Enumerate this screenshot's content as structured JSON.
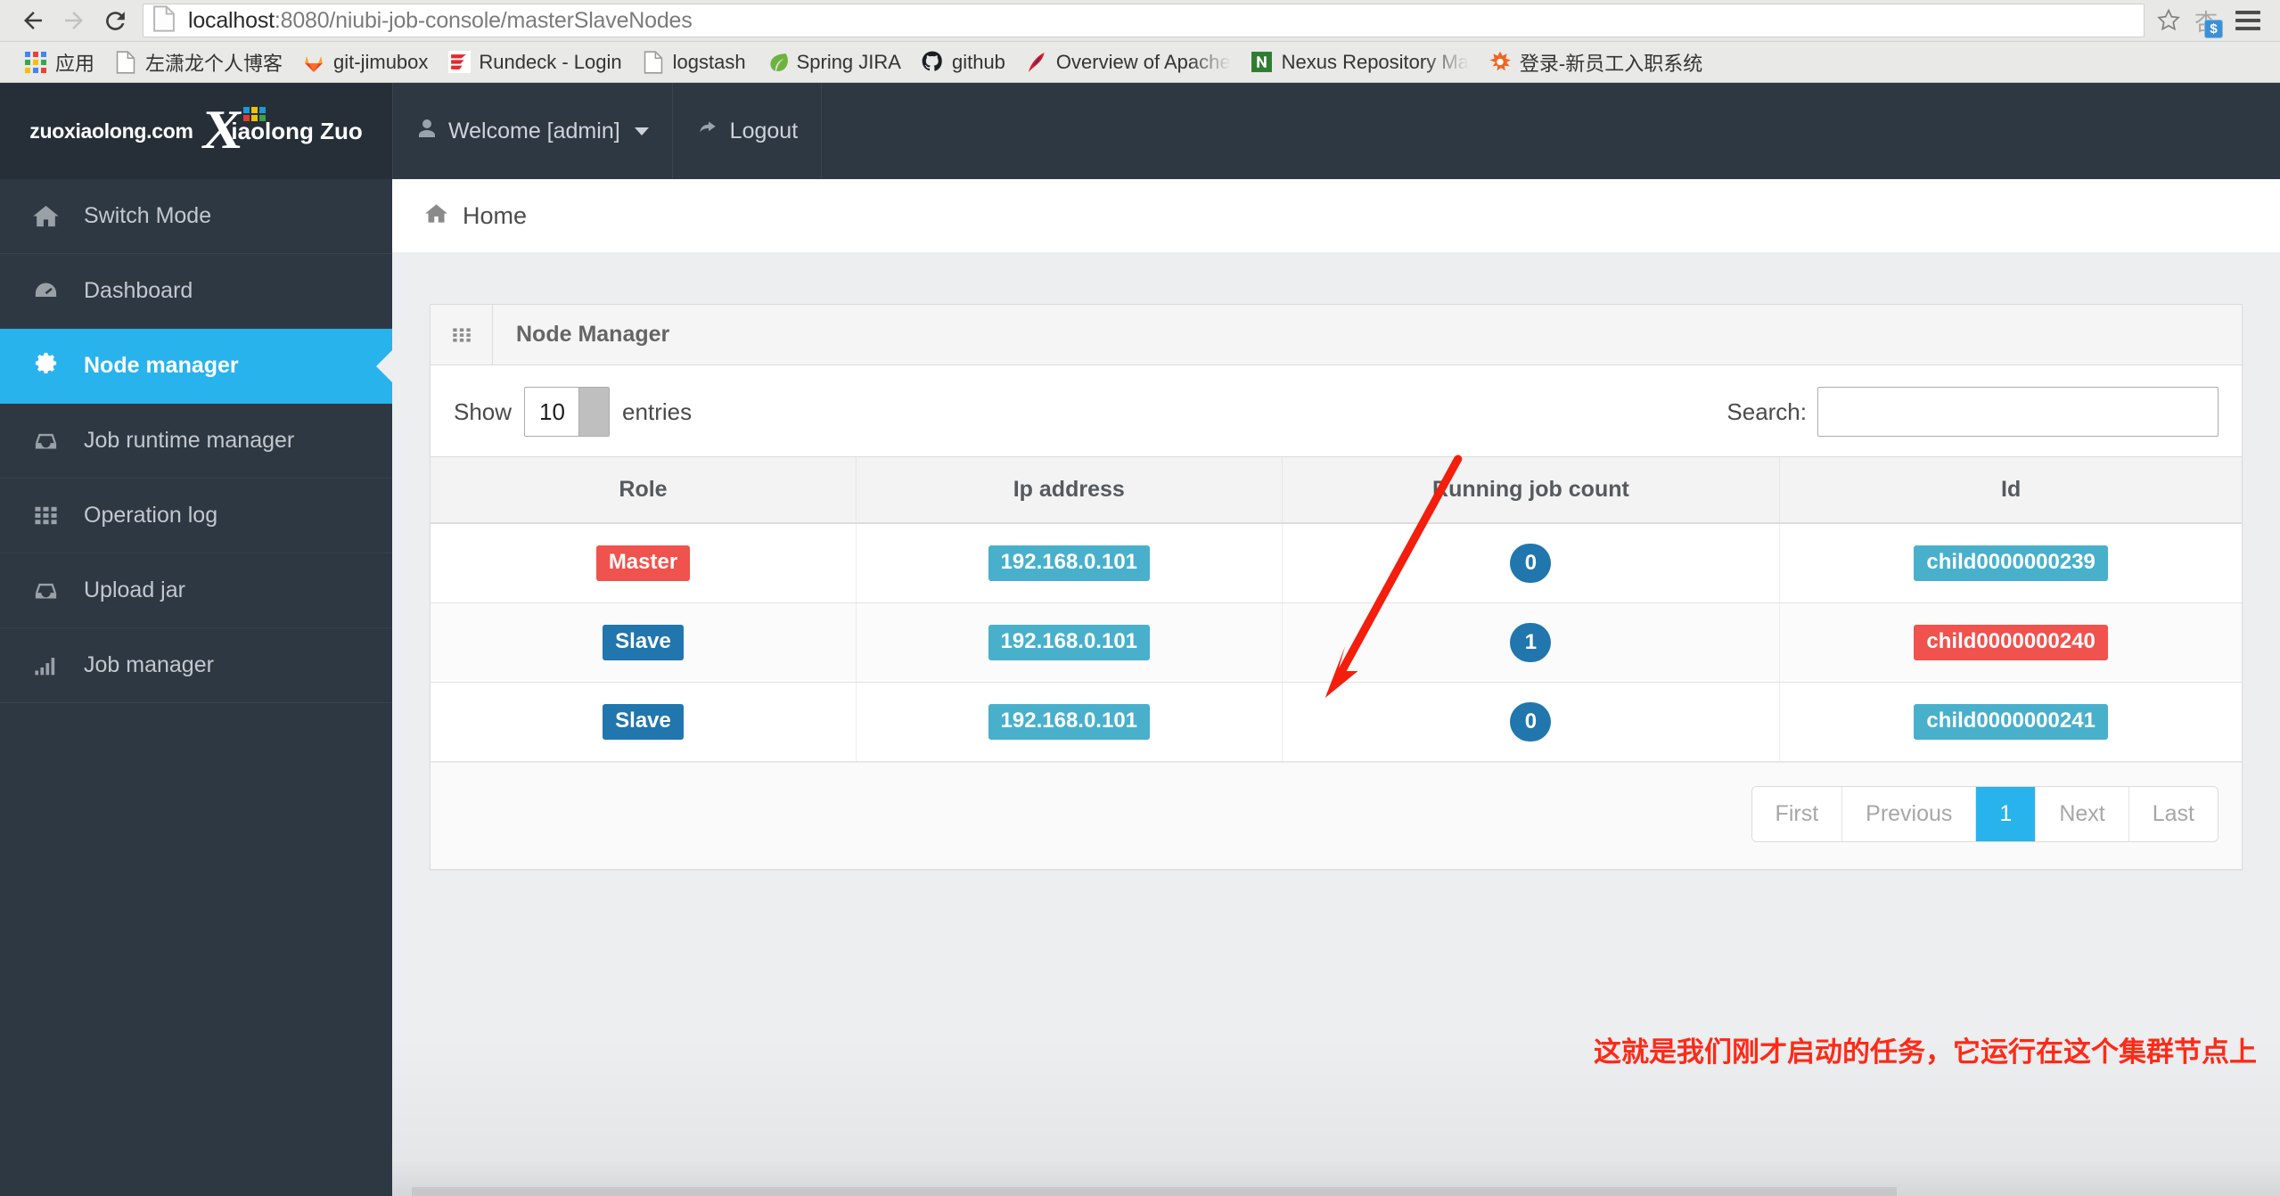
{
  "browser": {
    "back_icon": "back-arrow-icon",
    "forward_icon": "forward-arrow-icon",
    "reload_icon": "reload-icon",
    "url_host": "localhost",
    "url_rest": ":8080/niubi-job-console/masterSlaveNodes",
    "url_full": "localhost:8080/niubi-job-console/masterSlaveNodes",
    "star_icon": "bookmark-star-icon",
    "extension_glyph": "杏",
    "extension_badge": "$",
    "menu_icon": "hamburger-menu-icon",
    "bookmarks": [
      {
        "label": "应用",
        "icon": "apps-grid-icon"
      },
      {
        "label": "左潇龙个人博客",
        "icon": "page-doc-icon"
      },
      {
        "label": "git-jimubox",
        "icon": "gitlab-fox-icon"
      },
      {
        "label": "Rundeck - Login",
        "icon": "rundeck-icon"
      },
      {
        "label": "logstash",
        "icon": "page-doc-icon"
      },
      {
        "label": "Spring JIRA",
        "icon": "spring-leaf-icon"
      },
      {
        "label": "github",
        "icon": "github-octocat-icon"
      },
      {
        "label": "Overview of Apache",
        "icon": "apache-feather-icon",
        "truncated": true
      },
      {
        "label": "Nexus Repository Ma",
        "icon": "nexus-n-icon",
        "truncated": true
      },
      {
        "label": "登录-新员工入职系统",
        "icon": "orange-burst-icon"
      }
    ]
  },
  "sidebar": {
    "brand_text": "zuoxiaolong.com",
    "brand_logo_x": "X",
    "brand_logo_name": "iaolong Zuo",
    "items": [
      {
        "label": "Switch Mode",
        "icon": "home-icon",
        "active": false
      },
      {
        "label": "Dashboard",
        "icon": "dashboard-icon",
        "active": false
      },
      {
        "label": "Node manager",
        "icon": "gear-icon",
        "active": true
      },
      {
        "label": "Job runtime manager",
        "icon": "inbox-icon",
        "active": false
      },
      {
        "label": "Operation log",
        "icon": "grid-icon",
        "active": false
      },
      {
        "label": "Upload jar",
        "icon": "inbox-icon",
        "active": false
      },
      {
        "label": "Job manager",
        "icon": "bar-chart-icon",
        "active": false
      }
    ]
  },
  "topbar": {
    "welcome_label": "Welcome [admin]",
    "welcome_icon": "user-icon",
    "logout_label": "Logout",
    "logout_icon": "sign-out-icon"
  },
  "breadcrumb": {
    "icon": "home-icon",
    "label": "Home"
  },
  "panel": {
    "icon": "grid-icon",
    "title": "Node Manager",
    "length_prefix": "Show",
    "length_value": "10",
    "length_suffix": "entries",
    "search_label": "Search:",
    "search_value": "",
    "search_placeholder": "",
    "columns": [
      "Role",
      "Ip address",
      "Running job count",
      "Id"
    ],
    "rows": [
      {
        "role": "Master",
        "role_style": "danger",
        "ip": "192.168.0.101",
        "count": "0",
        "id": "child0000000239",
        "id_style": "info"
      },
      {
        "role": "Slave",
        "role_style": "primary",
        "ip": "192.168.0.101",
        "count": "1",
        "id": "child0000000240",
        "id_style": "danger"
      },
      {
        "role": "Slave",
        "role_style": "primary",
        "ip": "192.168.0.101",
        "count": "0",
        "id": "child0000000241",
        "id_style": "info"
      }
    ],
    "pagination": {
      "first": "First",
      "previous": "Previous",
      "pages": [
        "1"
      ],
      "current": "1",
      "next": "Next",
      "last": "Last"
    }
  },
  "annotation": {
    "text": "这就是我们刚才启动的任务，它运行在这个集群节点上",
    "color": "#ff2a17",
    "arrow": "red-arrow-annotation"
  },
  "colors": {
    "sidebar_bg": "#2e3843",
    "sidebar_brand_bg": "#262f38",
    "accent": "#29b3ec",
    "label_danger": "#f0524d",
    "label_primary": "#2176ad",
    "label_info": "#49b0cc",
    "content_bg": "#eceef0",
    "annotation_red": "#ff2a17"
  }
}
